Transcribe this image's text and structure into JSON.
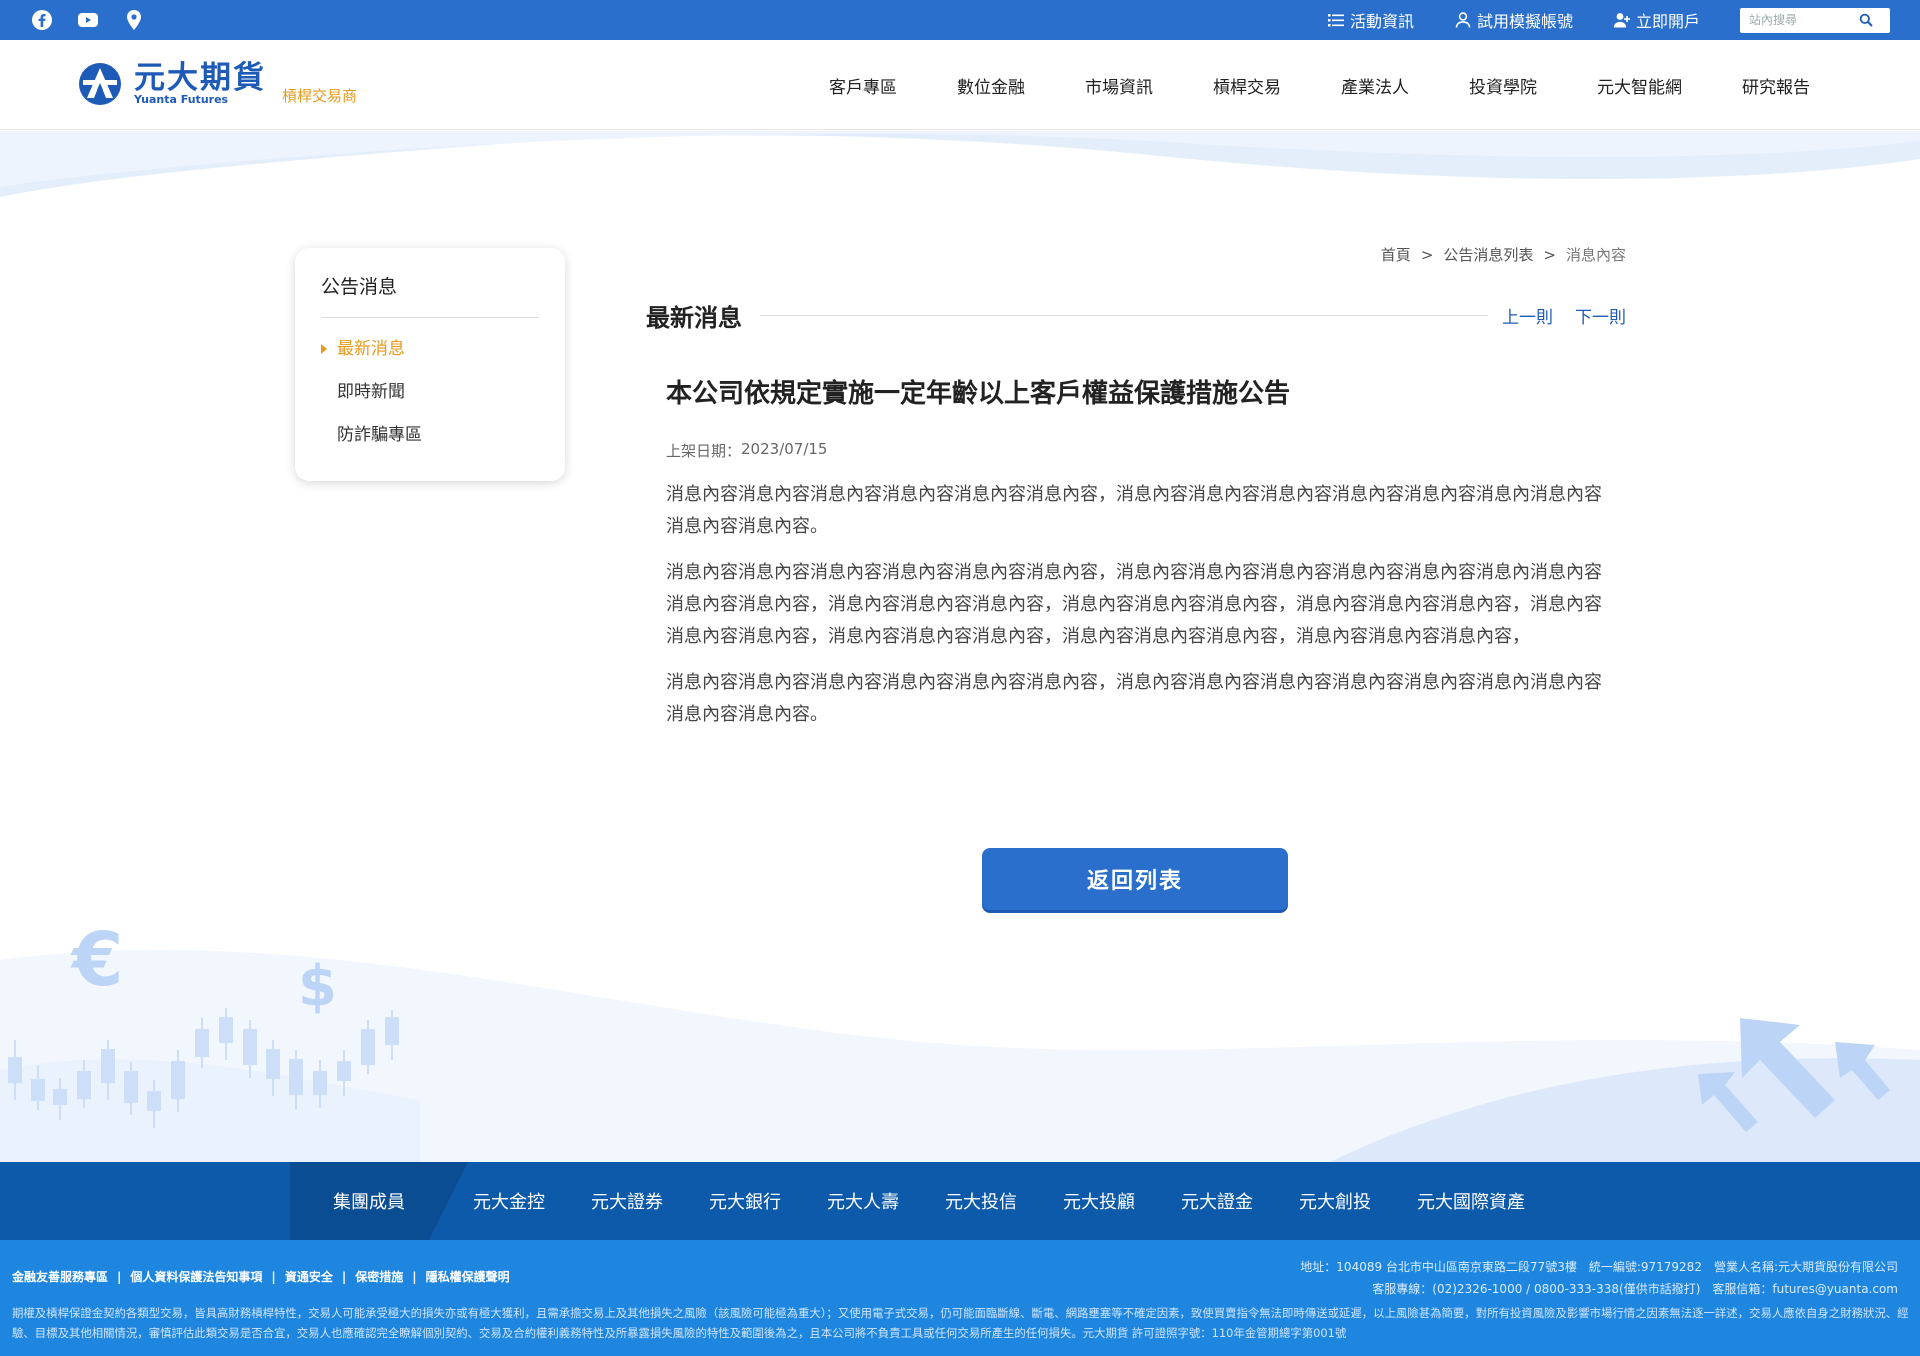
{
  "topbar": {
    "social": [
      "facebook-icon",
      "youtube-icon",
      "map-pin-icon"
    ],
    "links": [
      {
        "label": "活動資訊",
        "icon": "list-icon"
      },
      {
        "label": "試用模擬帳號",
        "icon": "user-icon"
      },
      {
        "label": "立即開戶",
        "icon": "user-plus-icon"
      }
    ],
    "search_placeholder": "站內搜尋"
  },
  "header": {
    "logo_cn": "元大期貨",
    "logo_en": "Yuanta Futures",
    "logo_sub": "槓桿交易商",
    "nav": [
      "客戶專區",
      "數位金融",
      "市場資訊",
      "槓桿交易",
      "產業法人",
      "投資學院",
      "元大智能網",
      "研究報告"
    ]
  },
  "sidebar": {
    "title": "公告消息",
    "items": [
      {
        "label": "最新消息",
        "active": true
      },
      {
        "label": "即時新聞",
        "active": false
      },
      {
        "label": "防詐騙專區",
        "active": false
      }
    ]
  },
  "breadcrumb": {
    "home": "首頁",
    "list": "公告消息列表",
    "current": "消息內容",
    "sep": ">"
  },
  "section": {
    "title": "最新消息",
    "prev": "上一則",
    "next": "下一則"
  },
  "article": {
    "title": "本公司依規定實施一定年齡以上客戶權益保護措施公告",
    "date_label": "上架日期：",
    "date": "2023/07/15",
    "paragraphs": [
      "消息內容消息內容消息內容消息內容消息內容消息內容，消息內容消息內容消息內容消息內容消息內容消息內消息內容消息內容消息內容。",
      "消息內容消息內容消息內容消息內容消息內容消息內容，消息內容消息內容消息內容消息內容消息內容消息內消息內容消息內容消息內容，消息內容消息內容消息內容，消息內容消息內容消息內容，消息內容消息內容消息內容，消息內容消息內容消息內容，消息內容消息內容消息內容，消息內容消息內容消息內容，消息內容消息內容消息內容，",
      "消息內容消息內容消息內容消息內容消息內容消息內容，消息內容消息內容消息內容消息內容消息內容消息內消息內容消息內容消息內容。"
    ],
    "back_button": "返回列表"
  },
  "group_bar": {
    "label": "集團成員",
    "members": [
      "元大金控",
      "元大證券",
      "元大銀行",
      "元大人壽",
      "元大投信",
      "元大投顧",
      "元大證金",
      "元大創投",
      "元大國際資產"
    ]
  },
  "footer": {
    "links": [
      "金融友善服務專區",
      "個人資料保護法告知事項",
      "資通安全",
      "保密措施",
      "隱私權保護聲明"
    ],
    "address_line": "地址：104089 台北市中山區南京東路二段77號3樓　統一編號:97179282　營業人名稱:元大期貨股份有限公司",
    "contact_line": "客服專線：(02)2326-1000 / 0800-333-338(僅供市話撥打)　客服信箱：futures@yuanta.com",
    "disclaimer": "期權及槓桿保證金契約各類型交易，皆具高財務槓桿特性，交易人可能承受極大的損失亦或有極大獲利，且需承擔交易上及其他損失之風險（該風險可能極為重大）；又使用電子式交易，仍可能面臨斷線、斷電、網路壅塞等不確定因素，致使買賣指令無法即時傳送或延遲，以上風險甚為簡要，對所有投資風險及影響市場行情之因素無法逐一詳述，交易人應依自身之財務狀況、經驗、目標及其他相關情況，審慎評估此類交易是否合宜，交易人也應確認完全瞭解個別契約、交易及合約權利義務特性及所暴露損失風險的特性及範圍後為之，且本公司將不負責工具或任何交易所產生的任何損失。元大期貨 許可證照字號：110年金管期總字第001號"
  },
  "colors": {
    "primary": "#2a6fcb",
    "accent": "#e59a1b",
    "group_bar": "#0c5aa9",
    "footer": "#1f86e0"
  }
}
